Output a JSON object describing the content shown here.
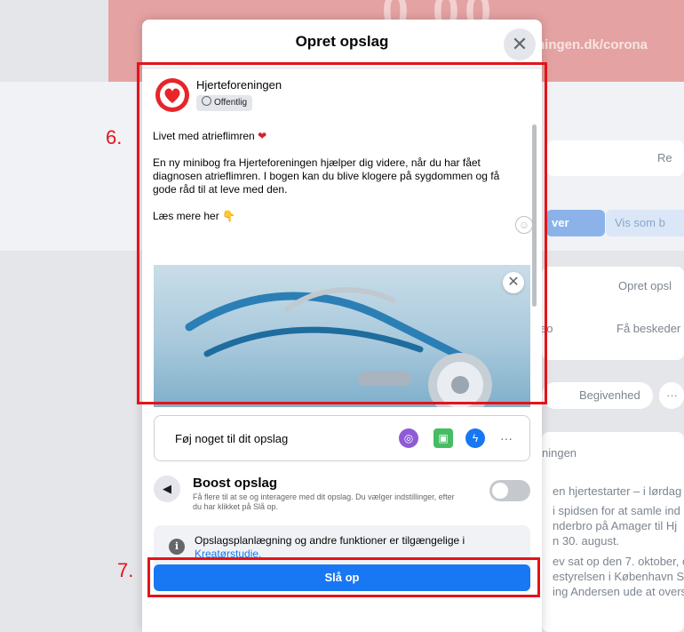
{
  "background": {
    "countdown": "0 00",
    "url": "ningen.dk/corona",
    "right_panel": {
      "rediger_label": "Re",
      "ver_label": "ver",
      "vis_som_label": "Vis som b",
      "opret_label": "Opret opsl",
      "eo_label": "eo",
      "besked_label": "Få beskeder",
      "begivenhed_label": "Begivenhed",
      "more_label": "···",
      "page_label": "ningen",
      "feed_lines": [
        "en hjertestarter – i lørdag",
        "i spidsen for at samle ind",
        "nderbro på Amager til Hj",
        "n 30. august.",
        "ev sat op den 7. oktober, o",
        "estyrelsen i København S,",
        "ing Andersen ude at overs"
      ]
    }
  },
  "modal": {
    "title": "Opret opslag",
    "close_symbol": "✕",
    "page_name": "Hjerteforeningen",
    "audience_label": "Offentlig",
    "post_lines": [
      "Livet med atrieflimren",
      "En ny minibog fra Hjerteforeningen hjælper dig videre, når du har fået diagnosen atrieflimren. I bogen kan du blive klogere på sygdommen og få gode råd til at leve med den.",
      "Læs mere her"
    ],
    "heart_emoji": "❤",
    "finger_emoji": "👇",
    "emoji_icon": "☺",
    "image_remove_symbol": "✕",
    "add_label": "Føj noget til dit opslag",
    "add_more": "···",
    "boost_title": "Boost opslag",
    "boost_desc": "Få flere til at se og interagere med dit opslag. Du vælger indstillinger, efter du har klikket på Slå op.",
    "boost_toggle_on": false,
    "info_text": "Opslagsplanlægning og andre funktioner er tilgængelige i",
    "info_link": "Kreatørstudie.",
    "post_button": "Slå op"
  },
  "annotations": {
    "step6_label": "6.",
    "step7_label": "7.",
    "highlight_color": "#e3141a"
  },
  "colors": {
    "primary": "#1877f2",
    "brand_red": "#e8252a"
  }
}
